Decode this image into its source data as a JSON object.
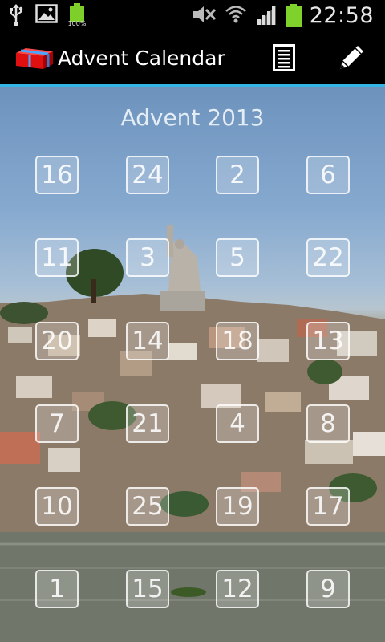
{
  "status_bar": {
    "time": "22:58",
    "battery_small_label": "100%",
    "icons": [
      "usb-icon",
      "image-icon",
      "battery-icon",
      "mute-icon",
      "wifi-icon",
      "signal-icon",
      "battery-icon"
    ]
  },
  "action_bar": {
    "title": "Advent Calendar",
    "icons": [
      "gift-icon",
      "list-icon",
      "pencil-icon"
    ],
    "accent_color": "#33b5e5"
  },
  "calendar": {
    "title": "Advent 2013",
    "doors": [
      {
        "day": "16"
      },
      {
        "day": "24"
      },
      {
        "day": "2"
      },
      {
        "day": "6"
      },
      {
        "day": "11"
      },
      {
        "day": "3"
      },
      {
        "day": "5"
      },
      {
        "day": "22"
      },
      {
        "day": "20"
      },
      {
        "day": "14"
      },
      {
        "day": "18"
      },
      {
        "day": "13"
      },
      {
        "day": "7"
      },
      {
        "day": "21"
      },
      {
        "day": "4"
      },
      {
        "day": "8"
      },
      {
        "day": "10"
      },
      {
        "day": "25"
      },
      {
        "day": "19"
      },
      {
        "day": "17"
      },
      {
        "day": "1"
      },
      {
        "day": "15"
      },
      {
        "day": "12"
      },
      {
        "day": "9"
      }
    ]
  }
}
